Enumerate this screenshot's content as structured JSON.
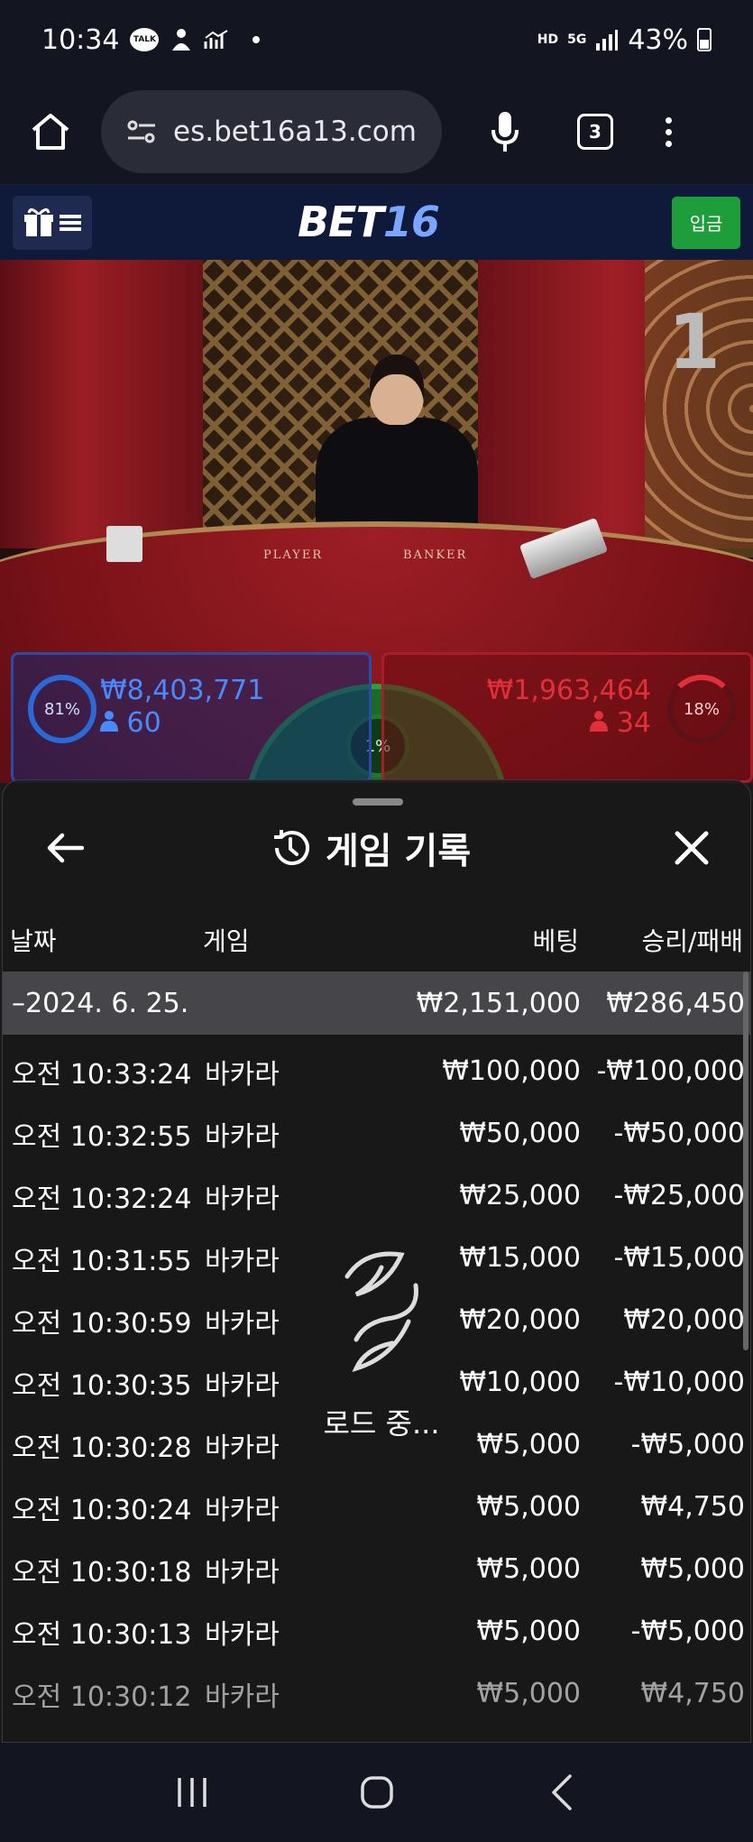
{
  "status_bar": {
    "time": "10:34",
    "talk": "TALK",
    "battery": "43%",
    "network_hd": "HD",
    "network_5g": "5G"
  },
  "browser": {
    "url": "es.bet16a13.com",
    "tab_count": "3"
  },
  "site_header": {
    "logo_a": "BET",
    "logo_b": "16",
    "deposit_label": "입금"
  },
  "video": {
    "table_number": "1",
    "felt_player": "PLAYER",
    "felt_banker": "BANKER",
    "player_percent": "81%",
    "player_amount": "₩8,403,771",
    "player_count": "60",
    "banker_percent": "18%",
    "banker_amount": "₩1,963,464",
    "banker_count": "34",
    "tie_percent": "1%"
  },
  "history": {
    "title": "게임 기록",
    "columns": {
      "date": "날짜",
      "game": "게임",
      "bet": "베팅",
      "winloss": "승리/패배"
    },
    "date_group": {
      "date": "–2024. 6. 25.",
      "bet": "₩2,151,000",
      "winloss": "₩286,450"
    },
    "rows": [
      {
        "time": "오전 10:33:24",
        "game": "바카라",
        "bet": "₩100,000",
        "winloss": "-₩100,000"
      },
      {
        "time": "오전 10:32:55",
        "game": "바카라",
        "bet": "₩50,000",
        "winloss": "-₩50,000"
      },
      {
        "time": "오전 10:32:24",
        "game": "바카라",
        "bet": "₩25,000",
        "winloss": "-₩25,000"
      },
      {
        "time": "오전 10:31:55",
        "game": "바카라",
        "bet": "₩15,000",
        "winloss": "-₩15,000"
      },
      {
        "time": "오전 10:30:59",
        "game": "바카라",
        "bet": "₩20,000",
        "winloss": "₩20,000"
      },
      {
        "time": "오전 10:30:35",
        "game": "바카라",
        "bet": "₩10,000",
        "winloss": "-₩10,000"
      },
      {
        "time": "오전 10:30:28",
        "game": "바카라",
        "bet": "₩5,000",
        "winloss": "-₩5,000"
      },
      {
        "time": "오전 10:30:24",
        "game": "바카라",
        "bet": "₩5,000",
        "winloss": "₩4,750"
      },
      {
        "time": "오전 10:30:18",
        "game": "바카라",
        "bet": "₩5,000",
        "winloss": "₩5,000"
      },
      {
        "time": "오전 10:30:13",
        "game": "바카라",
        "bet": "₩5,000",
        "winloss": "-₩5,000"
      },
      {
        "time": "오전 10:30:12",
        "game": "바카라",
        "bet": "₩5,000",
        "winloss": "₩4,750"
      }
    ],
    "loading_text": "로드 중..."
  },
  "colors": {
    "player_blue": "#2a6ad8",
    "banker_red": "#e0303a",
    "tie_green": "#2aa03c",
    "deposit_green": "#1e9e3a"
  }
}
